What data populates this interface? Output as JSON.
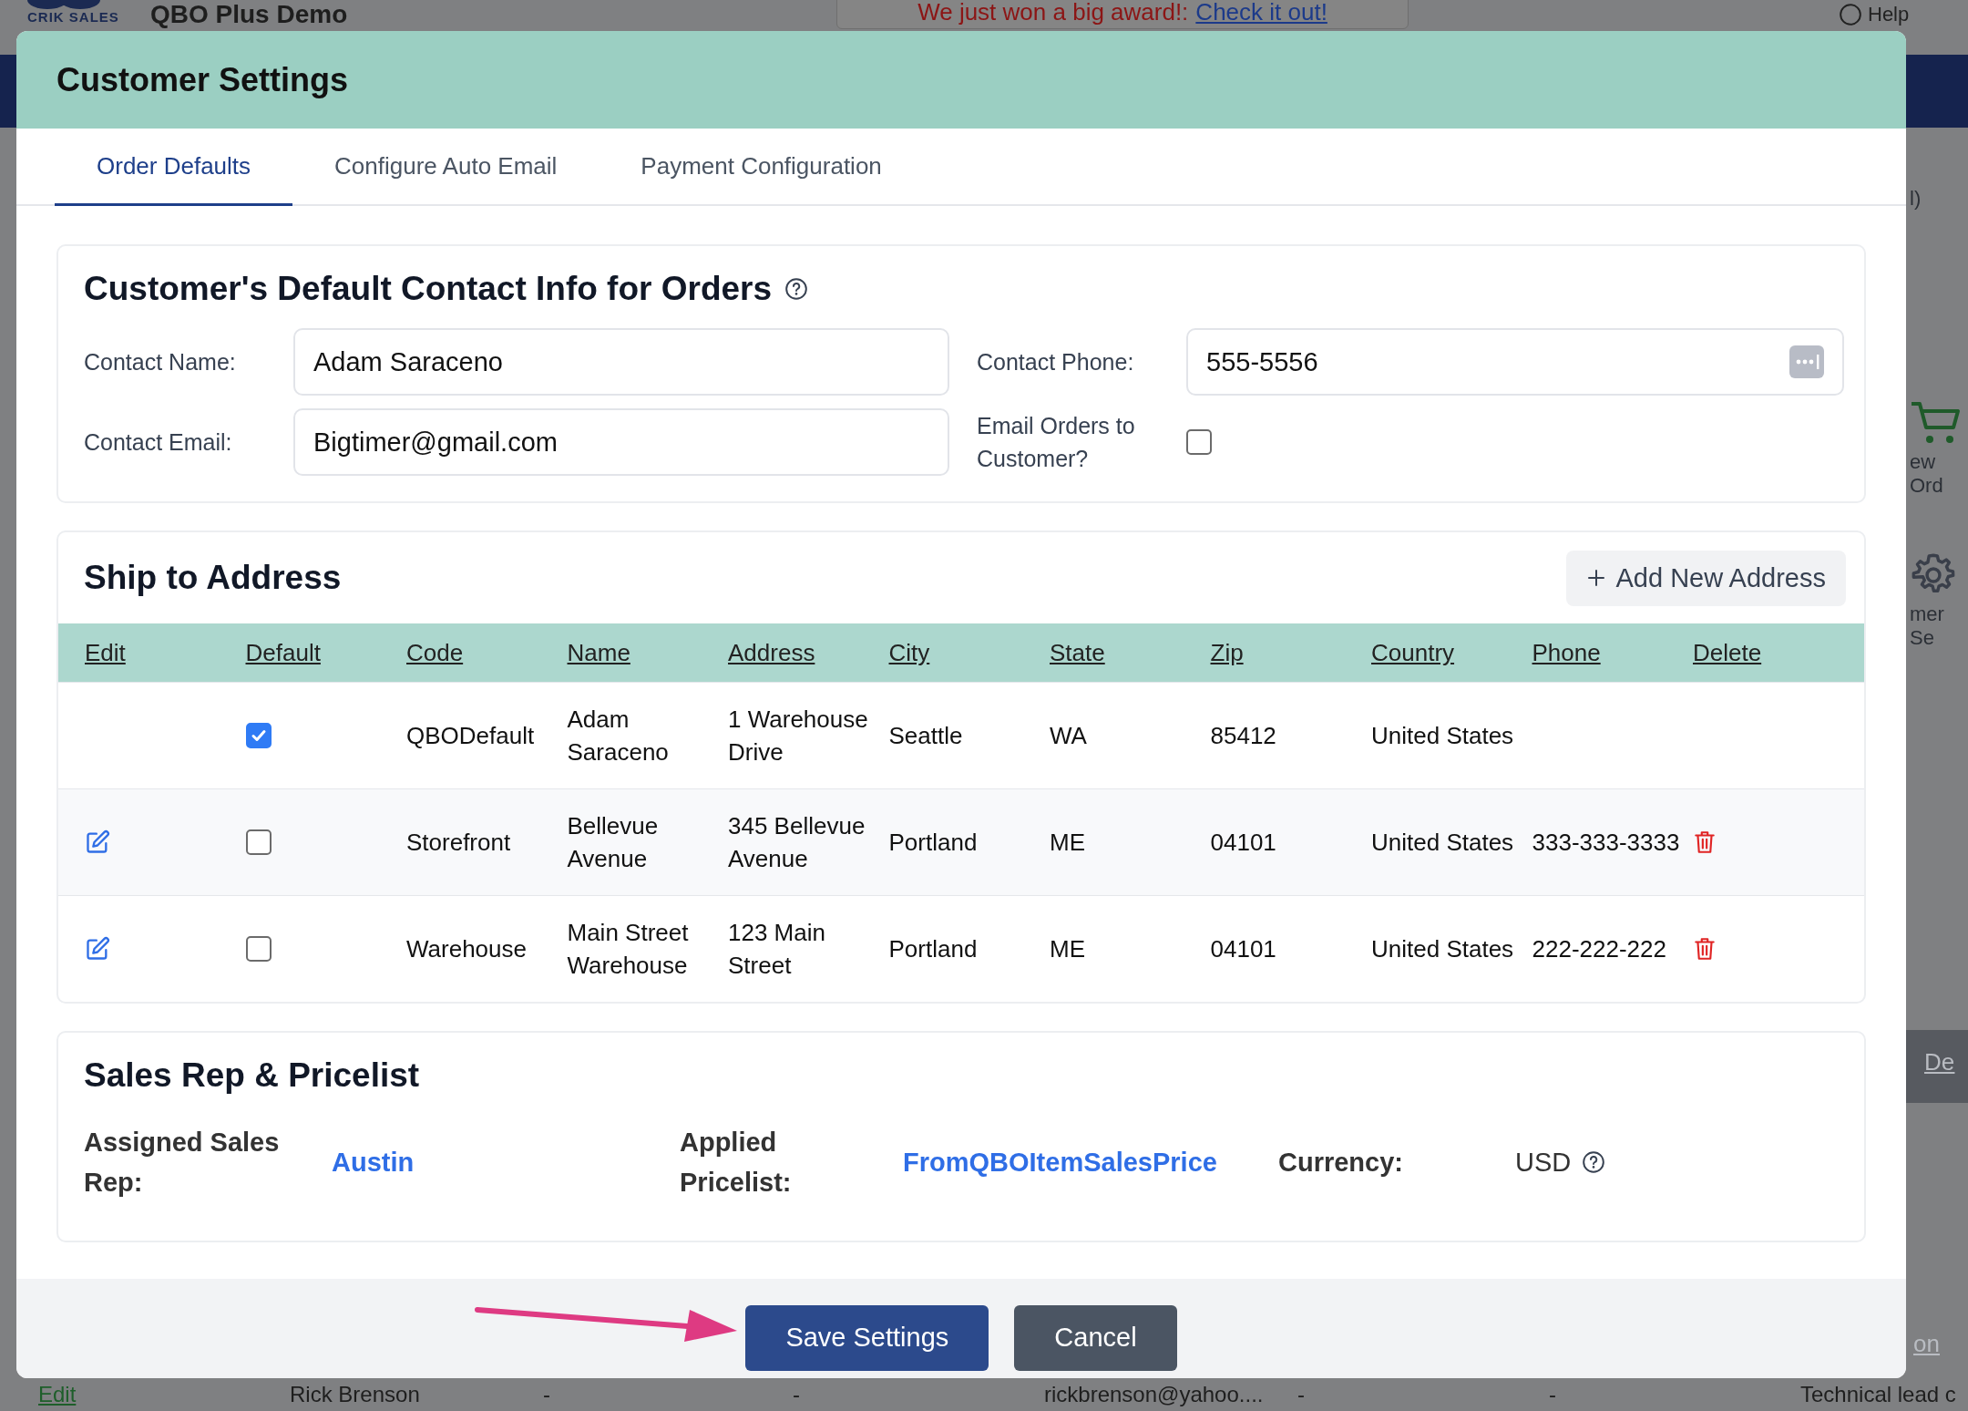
{
  "backdrop": {
    "logo_text": "CRIK SALES",
    "app_title": "QBO Plus Demo",
    "banner_text": "We just won a big award!:",
    "banner_link": "Check it out!",
    "help": "Help",
    "side_texts": [
      {
        "kind": "text",
        "text": "l)"
      },
      {
        "kind": "cart",
        "text": "ew Ord"
      },
      {
        "kind": "gear",
        "text": "mer Se"
      },
      {
        "kind": "link",
        "text": "De"
      },
      {
        "kind": "link",
        "text": "on"
      }
    ],
    "row": [
      {
        "kind": "link",
        "text": "Edit"
      },
      {
        "kind": "text",
        "text": "Rick Brenson"
      },
      {
        "kind": "text",
        "text": "-"
      },
      {
        "kind": "text",
        "text": "-"
      },
      {
        "kind": "text",
        "text": "rickbrenson@yahoo...."
      },
      {
        "kind": "text",
        "text": "-"
      },
      {
        "kind": "text",
        "text": "-"
      },
      {
        "kind": "text",
        "text": "Technical lead c"
      }
    ]
  },
  "modal": {
    "title": "Customer Settings",
    "tabs": [
      {
        "label": "Order Defaults",
        "selected": true
      },
      {
        "label": "Configure Auto Email",
        "selected": false
      },
      {
        "label": "Payment Configuration",
        "selected": false
      }
    ],
    "contact": {
      "title": "Customer's Default Contact Info for Orders",
      "name_label": "Contact Name:",
      "name_value": "Adam Saraceno",
      "phone_label": "Contact Phone:",
      "phone_value": "555-5556",
      "email_label": "Contact Email:",
      "email_value": "Bigtimer@gmail.com",
      "email_orders_label": "Email Orders to Customer?",
      "email_orders_checked": false
    },
    "ship": {
      "title": "Ship to Address",
      "add_button": "Add New Address",
      "columns": [
        "Edit",
        "Default",
        "Code",
        "Name",
        "Address",
        "City",
        "State",
        "Zip",
        "Country",
        "Phone",
        "Delete"
      ],
      "rows": [
        {
          "editable": false,
          "default": true,
          "code": "QBODefault",
          "name": "Adam Saraceno",
          "address": "1 Warehouse Drive",
          "city": "Seattle",
          "state": "WA",
          "zip": "85412",
          "country": "United States",
          "phone": "",
          "deletable": false
        },
        {
          "editable": true,
          "default": false,
          "code": "Storefront",
          "name": "Bellevue Avenue",
          "address": "345 Bellevue Avenue",
          "city": "Portland",
          "state": "ME",
          "zip": "04101",
          "country": "United States",
          "phone": "333-333-3333",
          "deletable": true
        },
        {
          "editable": true,
          "default": false,
          "code": "Warehouse",
          "name": "Main Street Warehouse",
          "address": "123 Main Street",
          "city": "Portland",
          "state": "ME",
          "zip": "04101",
          "country": "United States",
          "phone": "222-222-222",
          "deletable": true
        }
      ]
    },
    "sales": {
      "title": "Sales Rep & Pricelist",
      "rep_label": "Assigned Sales Rep:",
      "rep_value": "Austin",
      "pricelist_label": "Applied Pricelist:",
      "pricelist_value": "FromQBOItemSalesPrice",
      "currency_label": "Currency:",
      "currency_value": "USD"
    },
    "buttons": [
      {
        "kind": "primary",
        "label": "Save Settings"
      },
      {
        "kind": "secondary",
        "label": "Cancel"
      }
    ],
    "pointer_arrow": true
  }
}
